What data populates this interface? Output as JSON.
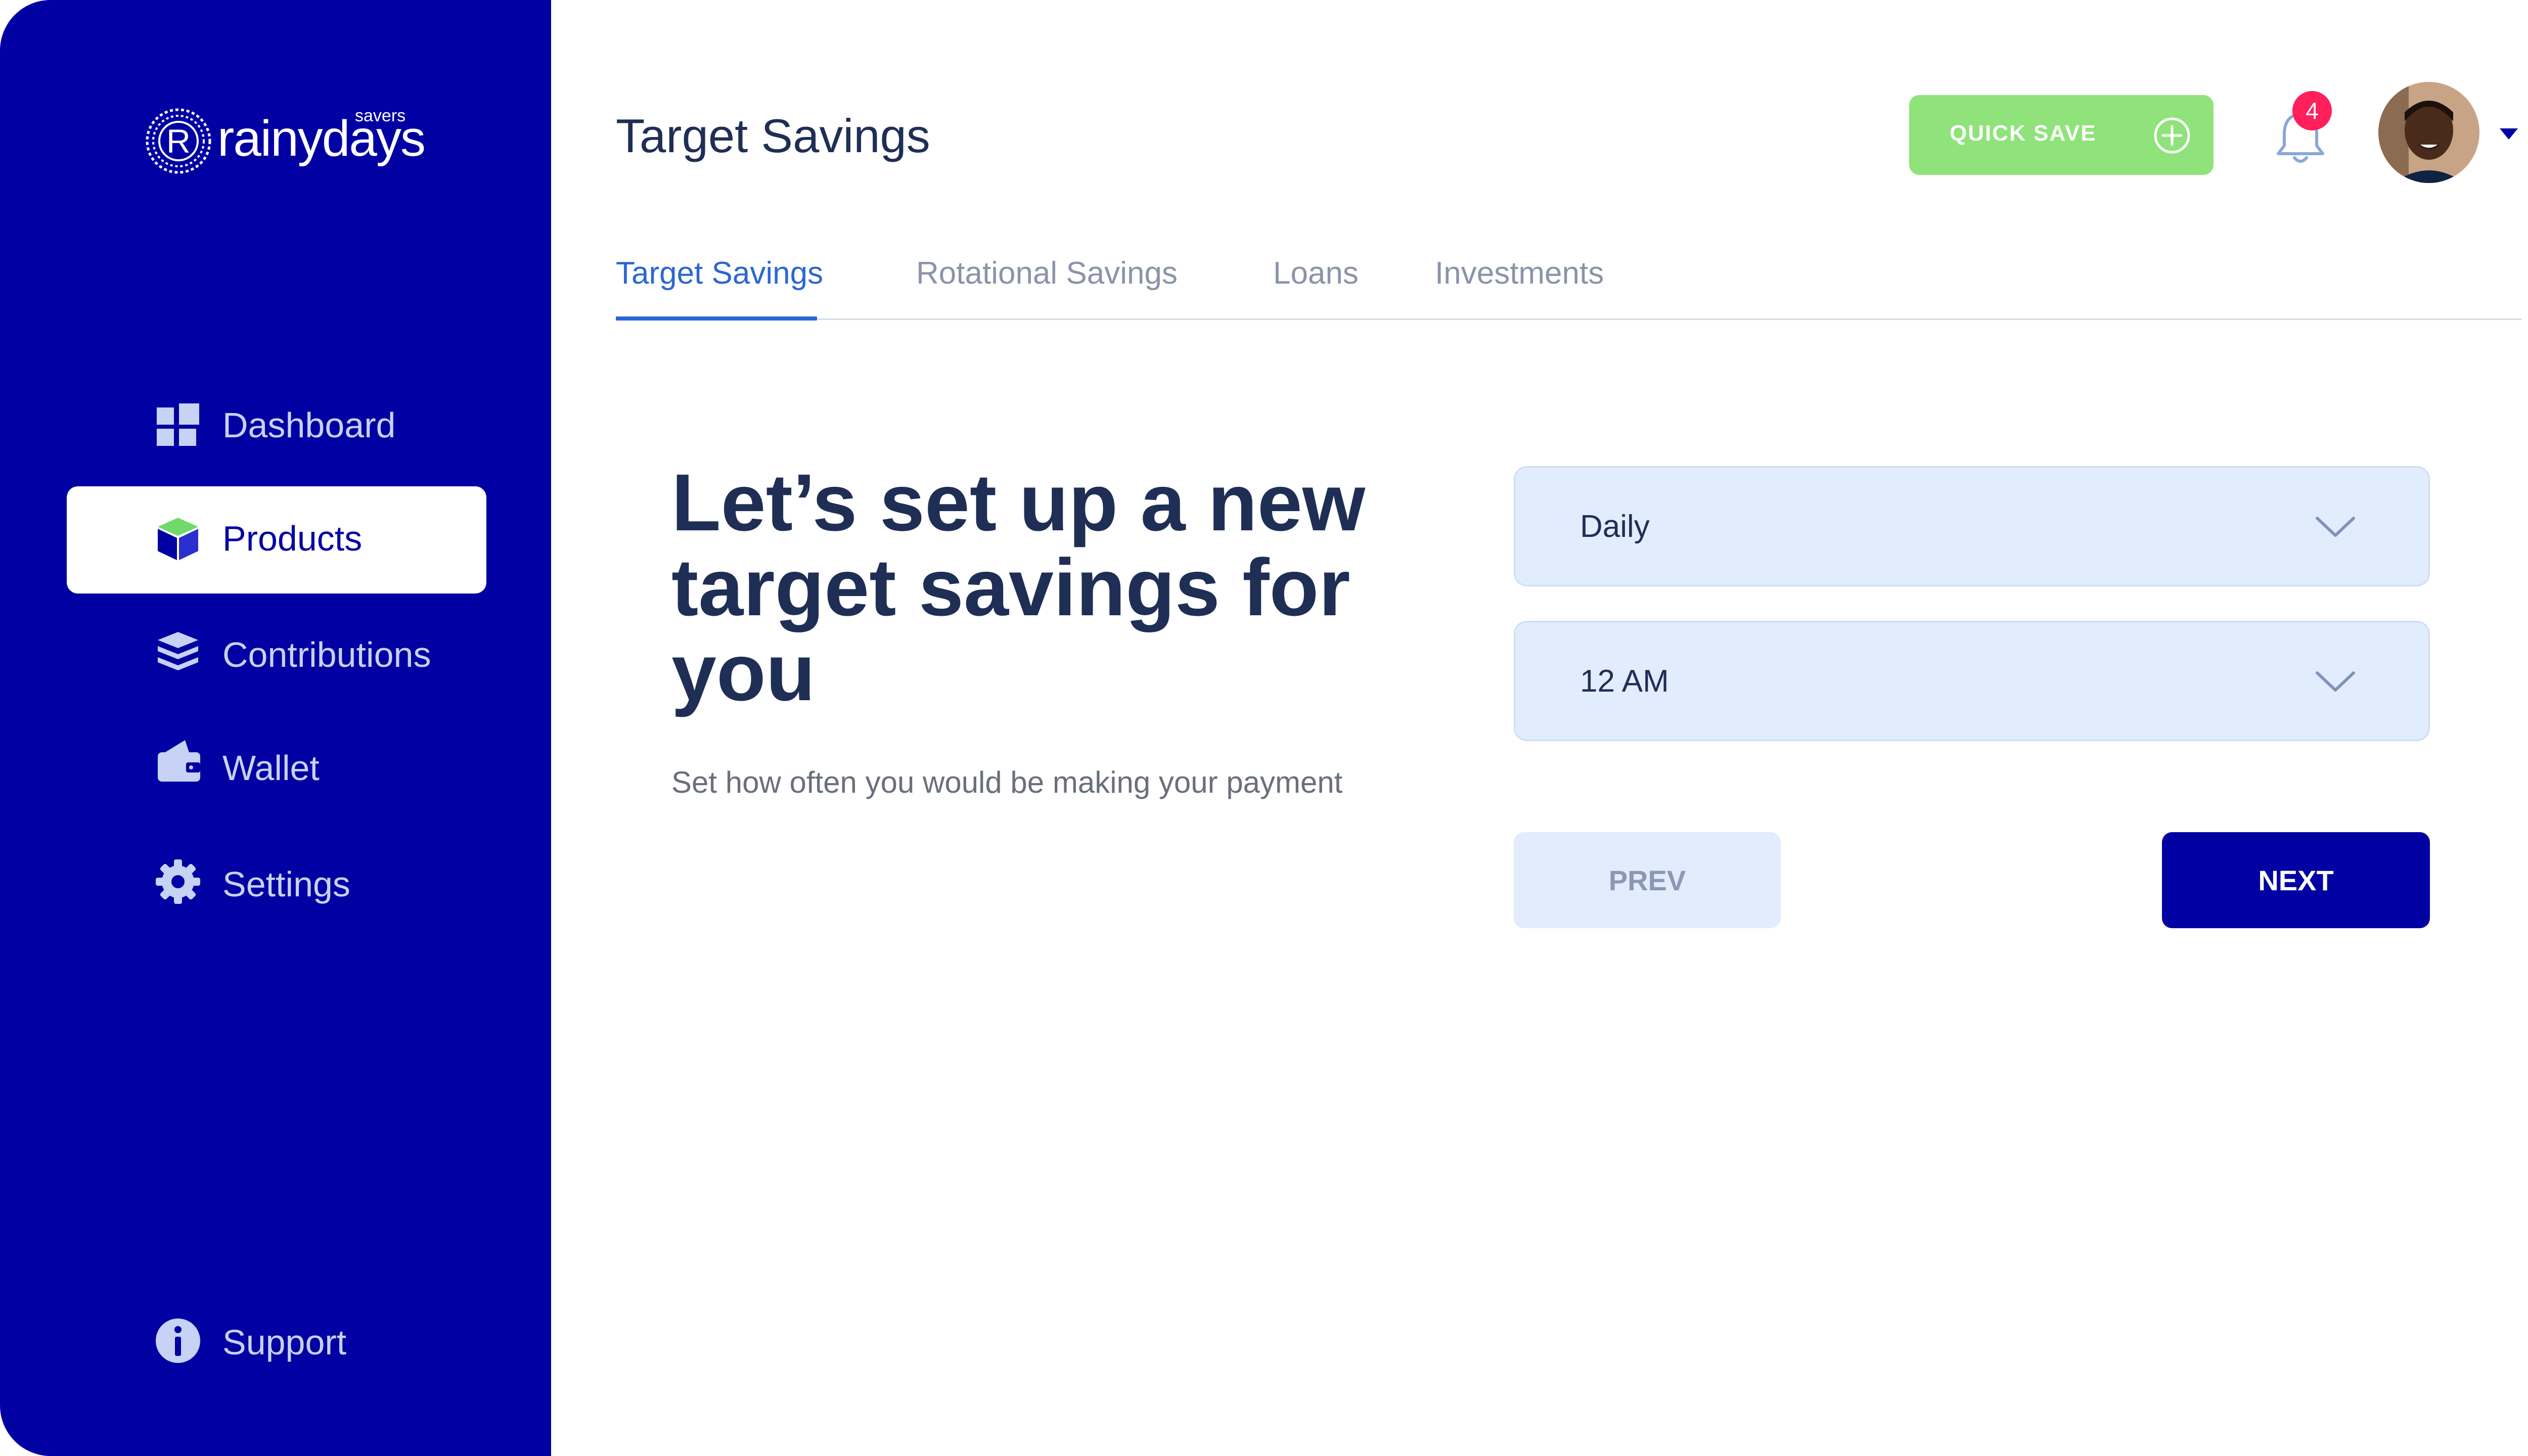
{
  "brand": {
    "name": "rainydays",
    "superscript": "savers",
    "mark_letter": "R"
  },
  "sidebar": {
    "items": [
      {
        "label": "Dashboard",
        "icon": "dashboard-grid-icon",
        "active": false
      },
      {
        "label": "Products",
        "icon": "box-icon",
        "active": true
      },
      {
        "label": "Contributions",
        "icon": "stacked-layers-icon",
        "active": false
      },
      {
        "label": "Wallet",
        "icon": "wallet-icon",
        "active": false
      },
      {
        "label": "Settings",
        "icon": "gear-icon",
        "active": false
      }
    ],
    "support": {
      "label": "Support",
      "icon": "info-icon"
    }
  },
  "header": {
    "title": "Target Savings",
    "quick_save_label": "QUICK SAVE",
    "quick_save_icon": "plus-circle-icon",
    "notification_count": "4"
  },
  "tabs": [
    {
      "label": "Target Savings",
      "active": true
    },
    {
      "label": "Rotational Savings",
      "active": false
    },
    {
      "label": "Loans",
      "active": false
    },
    {
      "label": "Investments",
      "active": false
    }
  ],
  "main": {
    "headline": "Let’s set up a new target savings for you",
    "subtext": "Set how often you would be making your payment",
    "frequency_select": {
      "value": "Daily"
    },
    "time_select": {
      "value": "12 AM"
    },
    "prev_label": "PREV",
    "next_label": "NEXT"
  },
  "colors": {
    "sidebar_bg": "#0100a3",
    "accent_blue": "#2b67d4",
    "quick_save_green": "#8fe37a",
    "badge_red": "#ff1f5b",
    "select_bg": "#e1ecfd",
    "heading_navy": "#1f2e55"
  }
}
